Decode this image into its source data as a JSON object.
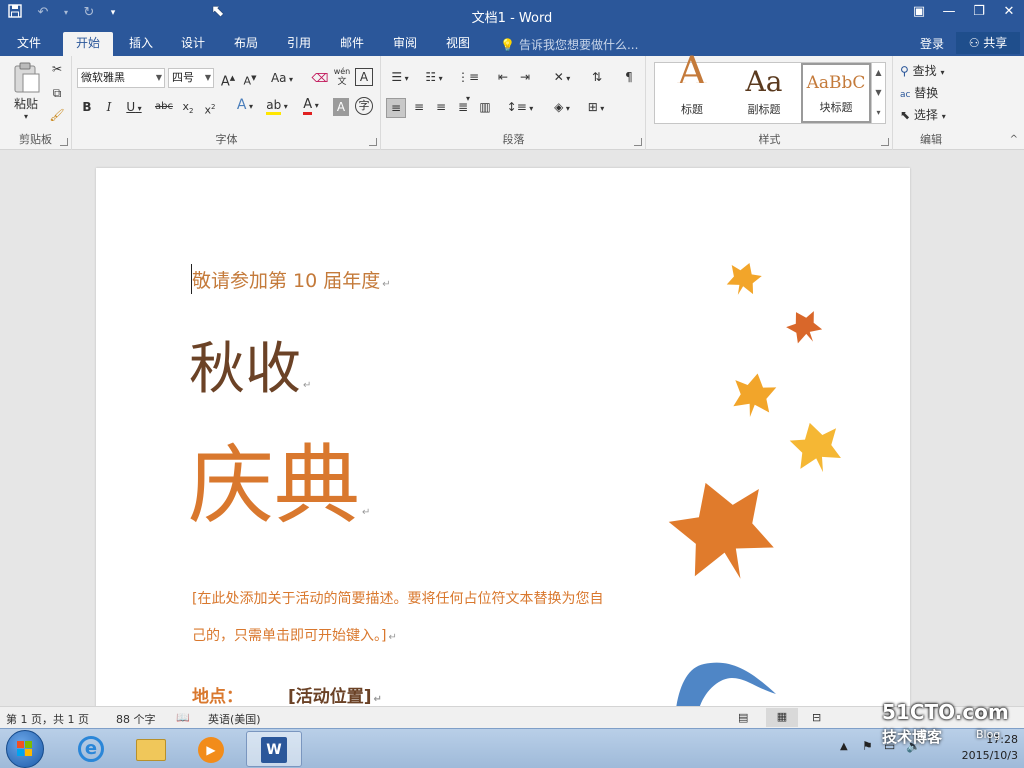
{
  "window": {
    "title": "文档1 - Word"
  },
  "tabs": [
    {
      "label": "文件"
    },
    {
      "label": "开始"
    },
    {
      "label": "插入"
    },
    {
      "label": "设计"
    },
    {
      "label": "布局"
    },
    {
      "label": "引用"
    },
    {
      "label": "邮件"
    },
    {
      "label": "审阅"
    },
    {
      "label": "视图"
    }
  ],
  "tell_me": {
    "placeholder": "告诉我您想要做什么..."
  },
  "account": {
    "login": "登录",
    "share": "共享"
  },
  "ribbon": {
    "clipboard": {
      "paste": "粘贴",
      "label": "剪贴板"
    },
    "font": {
      "name": "微软雅黑",
      "size": "四号",
      "aa": "Aa",
      "wen": "wén",
      "label": "字体"
    },
    "paragraph": {
      "label": "段落"
    },
    "styles": {
      "label": "样式",
      "items": [
        {
          "preview": "A",
          "name": "标题"
        },
        {
          "preview": "Aa",
          "name": "副标题"
        },
        {
          "preview": "AaBbC",
          "name": "块标题"
        }
      ]
    },
    "editing": {
      "find": "查找",
      "replace": "替换",
      "select": "选择",
      "label": "编辑"
    }
  },
  "document": {
    "invite": "敬请参加第 10 届年度",
    "title1": "秋收",
    "title2": "庆典",
    "desc1": "[在此处添加关于活动的简要描述。要将任何占位符文本替换为您自",
    "desc2": "己的，只需单击即可开始键入。]",
    "location_label": "地点：",
    "location_value": "[活动位置]",
    "para_mark": "↵"
  },
  "status": {
    "page": "第 1 页，共 1 页",
    "words": "88 个字",
    "language": "英语(美国)"
  },
  "taskbar": {
    "time": "17:28",
    "date": "2015/10/3"
  },
  "watermark": {
    "line1": "51CTO.com",
    "line2": "技术博客",
    "line3": "Blog"
  },
  "colors": {
    "accent": "#2b579a",
    "title_brown": "#6b4226",
    "orange": "#d9782e"
  }
}
